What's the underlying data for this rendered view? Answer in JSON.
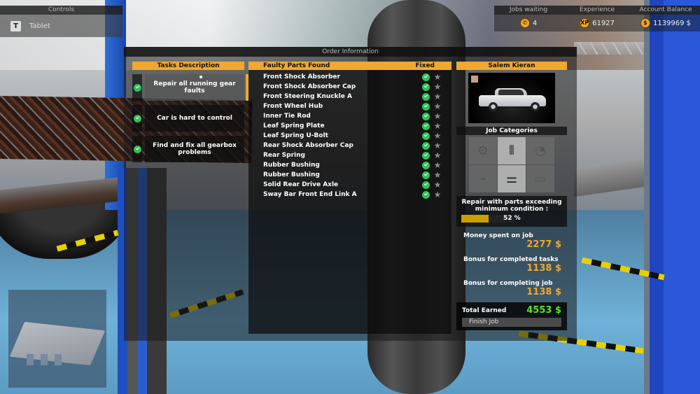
{
  "hud": {
    "controls": {
      "title": "Controls",
      "items": [
        {
          "key": "T",
          "label": "Tablet"
        }
      ]
    },
    "stats": {
      "headers": [
        "Jobs waiting",
        "Experience",
        "Account Balance"
      ],
      "jobs_waiting": {
        "icon": "phone-icon",
        "value": "4"
      },
      "experience": {
        "icon": "xp-icon",
        "icon_text": "XP",
        "value": "61927"
      },
      "account_balance": {
        "icon": "dollar-coin-icon",
        "icon_text": "$",
        "value": "1139969 $"
      }
    }
  },
  "order": {
    "title": "Order Information",
    "tasks": {
      "header": "Tasks Description",
      "items": [
        {
          "label": "Repair all running gear faults",
          "done": true,
          "active": true
        },
        {
          "label": "Car is hard to control",
          "done": true,
          "active": false
        },
        {
          "label": "Find and fix all gearbox problems",
          "done": true,
          "active": false
        }
      ]
    },
    "parts": {
      "header_name": "Faulty Parts Found",
      "header_fixed": "Fixed",
      "items": [
        {
          "name": "Front Shock Absorber",
          "fixed": true
        },
        {
          "name": "Front Shock Absorber Cap",
          "fixed": true
        },
        {
          "name": "Front Steering Knuckle A",
          "fixed": true
        },
        {
          "name": "Front Wheel Hub",
          "fixed": true
        },
        {
          "name": "Inner Tie Rod",
          "fixed": true
        },
        {
          "name": "Leaf Spring Plate",
          "fixed": true
        },
        {
          "name": "Leaf Spring U-Bolt",
          "fixed": true
        },
        {
          "name": "Rear Shock Absorber Cap",
          "fixed": true
        },
        {
          "name": "Rear Spring",
          "fixed": true
        },
        {
          "name": "Rubber Bushing",
          "fixed": true
        },
        {
          "name": "Rubber Bushing",
          "fixed": true
        },
        {
          "name": "Solid Rear Drive Axle",
          "fixed": true
        },
        {
          "name": "Sway Bar Front End Link A",
          "fixed": true
        }
      ]
    },
    "customer": {
      "name": "Salem Kieran",
      "car_color": "#c8a080",
      "job_categories_title": "Job Categories",
      "job_categories": [
        {
          "name": "engine",
          "active": false
        },
        {
          "name": "suspension",
          "active": true
        },
        {
          "name": "interior",
          "active": false
        },
        {
          "name": "exhaust",
          "active": false
        },
        {
          "name": "gearbox",
          "active": true
        },
        {
          "name": "body",
          "active": false
        }
      ],
      "condition_label": "Repair with parts exceeding minimum condition :",
      "condition_percent": 52,
      "condition_text": "52 %",
      "money_spent_label": "Money spent on job",
      "money_spent": "2277 $",
      "bonus_tasks_label": "Bonus for completed tasks",
      "bonus_tasks": "1138 $",
      "bonus_job_label": "Bonus for completing job",
      "bonus_job": "1138 $",
      "total_label": "Total Earned",
      "total": "4553 $",
      "finish_label": "Finish Job"
    }
  },
  "colors": {
    "accent": "#f0a830",
    "check": "#2ec25a",
    "total": "#5ce32a",
    "condition_bar": "#c9a000"
  }
}
